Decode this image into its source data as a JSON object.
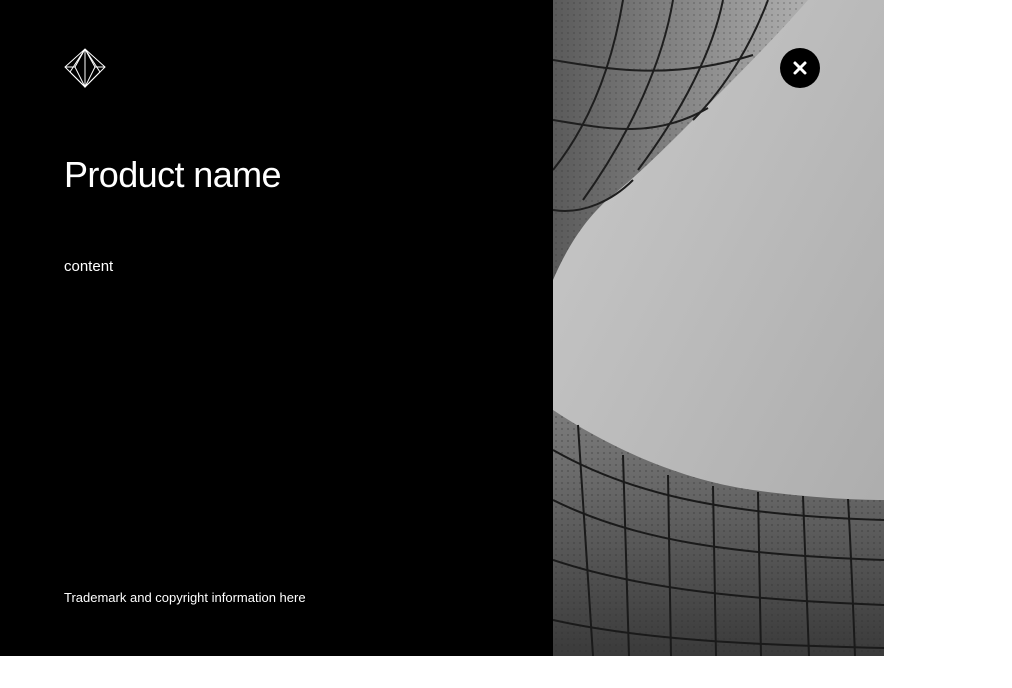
{
  "modal": {
    "brand": {
      "logo_icon": "diamond-logo-icon"
    },
    "title": "Product name",
    "content": "content",
    "trademark": "Trademark and copyright information here",
    "close": {
      "icon": "close-icon",
      "aria_label": "Close"
    },
    "image": {
      "subject": "black-and-white architectural photo of curved perforated facade against sky"
    }
  },
  "colors": {
    "panel_background": "#000000",
    "text": "#ffffff",
    "page_background": "#ffffff",
    "close_button": "#000000",
    "sky": "#bdbdbd",
    "facade": "#6e6e6e"
  }
}
